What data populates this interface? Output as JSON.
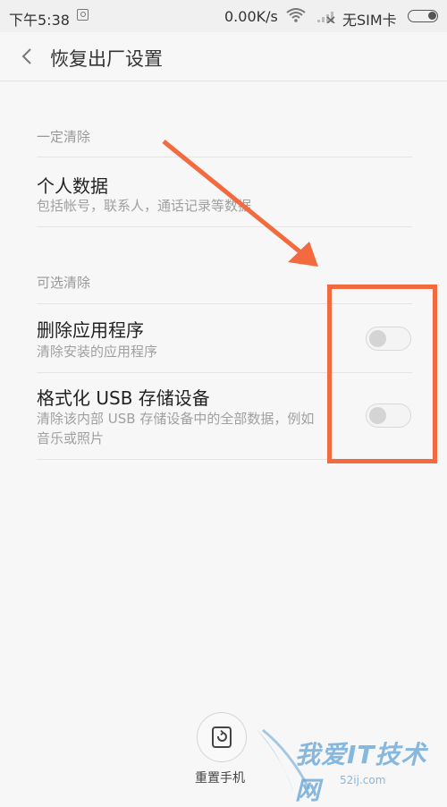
{
  "status_bar": {
    "time": "下午5:38",
    "net_speed": "0.00K/s",
    "sim_status": "无SIM卡",
    "icons": [
      "notification-icon",
      "wifi-icon",
      "signal-icon",
      "battery-icon"
    ]
  },
  "header": {
    "title": "恢复出厂设置",
    "back_icon": "chevron-left-icon"
  },
  "sections": {
    "required": {
      "label": "一定清除",
      "items": [
        {
          "title": "个人数据",
          "subtitle": "包括帐号，联系人，通话记录等数据"
        }
      ]
    },
    "optional": {
      "label": "可选清除",
      "items": [
        {
          "title": "删除应用程序",
          "subtitle": "清除安装的应用程序",
          "enabled": false
        },
        {
          "title": "格式化 USB 存储设备",
          "subtitle": "清除该内部 USB 存储设备中的全部数据，例如音乐或照片",
          "enabled": false
        }
      ]
    }
  },
  "footer": {
    "reset_label": "重置手机",
    "reset_icon": "reset-phone-icon"
  },
  "annotation": {
    "color": "#f26a3e"
  },
  "watermark": {
    "text": "我爱IT技术网",
    "url": "52ij.com"
  }
}
